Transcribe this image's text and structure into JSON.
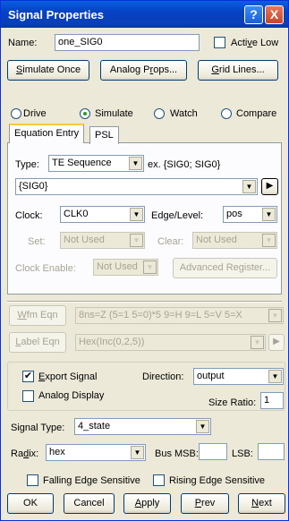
{
  "window": {
    "title": "Signal Properties",
    "help_icon": "?",
    "close_icon": "X"
  },
  "name": {
    "label": "Name:",
    "value": "one_SIG0"
  },
  "active_low": {
    "label": "Active Low",
    "checked": false
  },
  "buttons_top": {
    "simulate_once": "Simulate Once",
    "analog_props": "Analog Props...",
    "grid_lines": "Grid Lines..."
  },
  "mode": {
    "options": [
      "Drive",
      "Simulate",
      "Watch",
      "Compare"
    ],
    "selected": "Simulate"
  },
  "tabs": [
    {
      "label": "Equation Entry",
      "active": true
    },
    {
      "label": "PSL",
      "active": false
    }
  ],
  "equation": {
    "type_label": "Type:",
    "type_value": "TE Sequence",
    "example": "ex. {SIG0; SIG0}",
    "expression": "{SIG0}",
    "clock_label": "Clock:",
    "clock_value": "CLK0",
    "edge_label": "Edge/Level:",
    "edge_value": "pos",
    "set_label": "Set:",
    "set_value": "Not Used",
    "clear_label": "Clear:",
    "clear_value": "Not Used",
    "clock_enable_label": "Clock Enable:",
    "clock_enable_value": "Not Used",
    "advanced_register": "Advanced Register..."
  },
  "wfm": {
    "button": "Wfm Eqn",
    "value": "8ns=Z (5=1 5=0)*5 9=H 9=L 5=V 5=X"
  },
  "label_eqn": {
    "button": "Label Eqn",
    "value": "Hex(Inc(0,2,5))"
  },
  "export": {
    "export_signal_label": "Export Signal",
    "export_signal_checked": true,
    "direction_label": "Direction:",
    "direction_value": "output",
    "analog_display_label": "Analog Display",
    "analog_display_checked": false,
    "size_ratio_label": "Size Ratio:",
    "size_ratio_value": "1"
  },
  "signal_type": {
    "label": "Signal Type:",
    "value": "4_state"
  },
  "radix": {
    "label": "Radix:",
    "value": "hex",
    "bus_msb_label": "Bus MSB:",
    "bus_msb_value": "",
    "lsb_label": "LSB:",
    "lsb_value": ""
  },
  "edges": {
    "falling_label": "Falling Edge Sensitive",
    "rising_label": "Rising Edge Sensitive"
  },
  "footer": {
    "ok": "OK",
    "cancel": "Cancel",
    "apply": "Apply",
    "prev": "Prev",
    "next": "Next"
  },
  "colors": {
    "title_bar": "#0a5fe0",
    "dialog_bg": "#ece9d8",
    "check_green": "#21a121",
    "tab_highlight": "#ffc83c"
  }
}
